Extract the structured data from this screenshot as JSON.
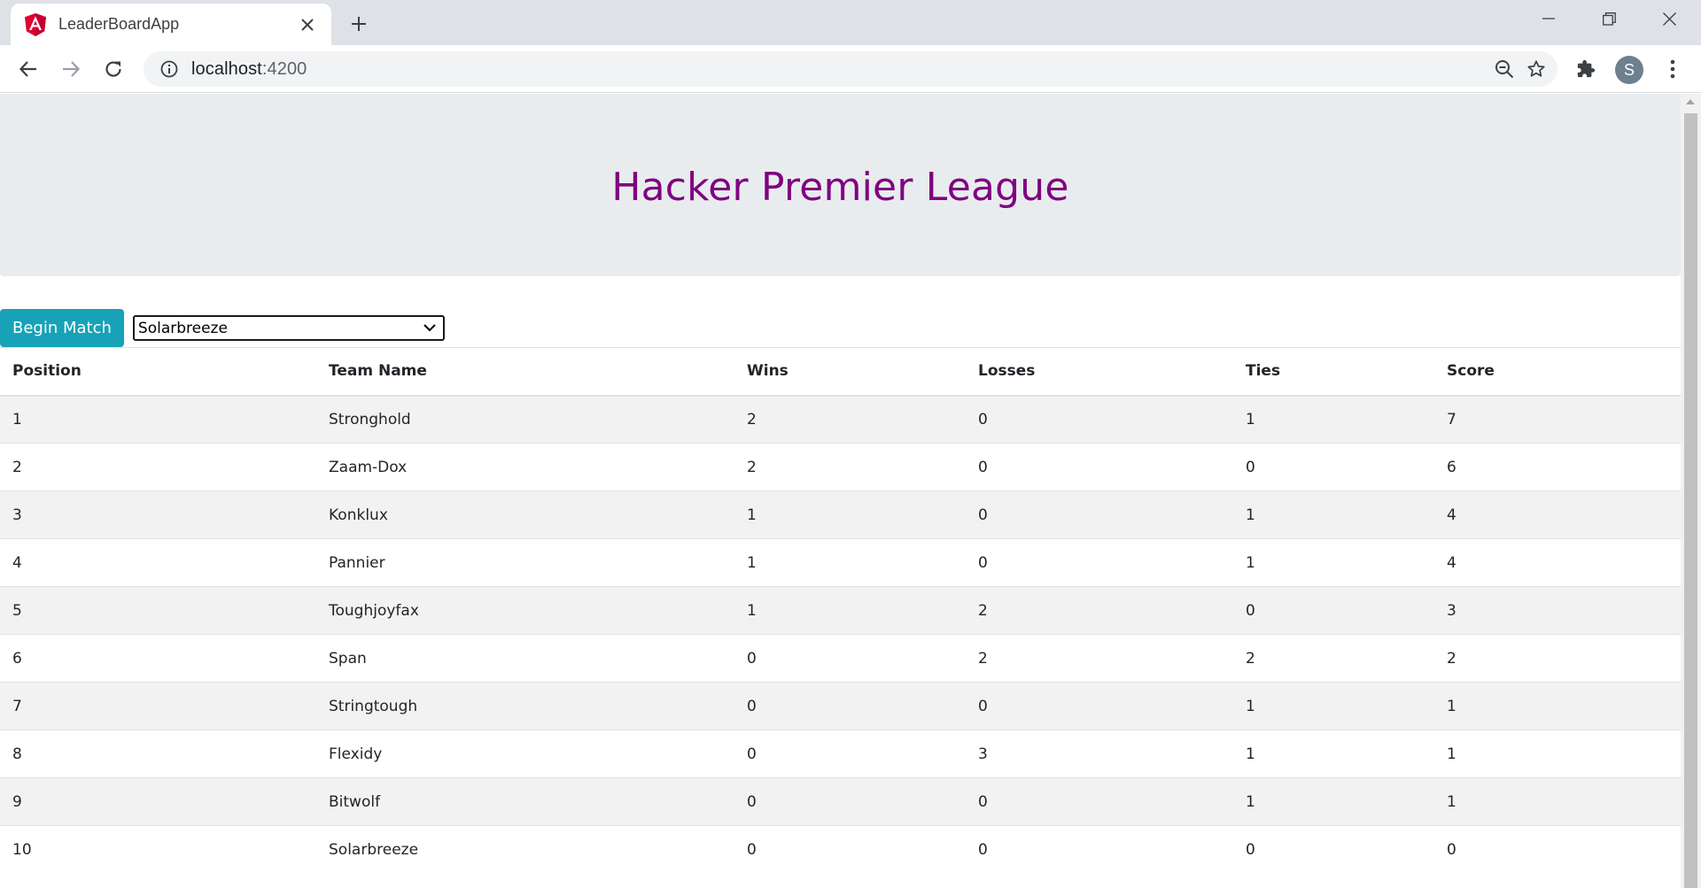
{
  "browser": {
    "tab_title": "LeaderBoardApp",
    "url_host": "localhost",
    "url_port": ":4200",
    "profile_initial": "S"
  },
  "colors": {
    "title": "#800080",
    "button": "#17a2b8",
    "header_band": "#e9ecef"
  },
  "page": {
    "title": "Hacker Premier League",
    "begin_button_label": "Begin Match",
    "team_select_value": "Solarbreeze"
  },
  "table": {
    "columns": [
      "Position",
      "Team Name",
      "Wins",
      "Losses",
      "Ties",
      "Score"
    ],
    "rows": [
      [
        "1",
        "Stronghold",
        "2",
        "0",
        "1",
        "7"
      ],
      [
        "2",
        "Zaam-Dox",
        "2",
        "0",
        "0",
        "6"
      ],
      [
        "3",
        "Konklux",
        "1",
        "0",
        "1",
        "4"
      ],
      [
        "4",
        "Pannier",
        "1",
        "0",
        "1",
        "4"
      ],
      [
        "5",
        "Toughjoyfax",
        "1",
        "2",
        "0",
        "3"
      ],
      [
        "6",
        "Span",
        "0",
        "2",
        "2",
        "2"
      ],
      [
        "7",
        "Stringtough",
        "0",
        "0",
        "1",
        "1"
      ],
      [
        "8",
        "Flexidy",
        "0",
        "3",
        "1",
        "1"
      ],
      [
        "9",
        "Bitwolf",
        "0",
        "0",
        "1",
        "1"
      ],
      [
        "10",
        "Solarbreeze",
        "0",
        "0",
        "0",
        "0"
      ]
    ]
  }
}
